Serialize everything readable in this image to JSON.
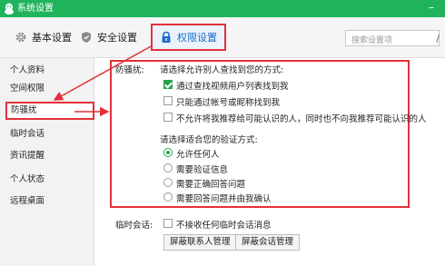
{
  "window": {
    "title": "系统设置",
    "minimize_glyph": "–",
    "logo_icon": "qq-penguin-icon"
  },
  "toolbar": {
    "tabs": [
      {
        "label": "基本设置",
        "icon": "gear-icon"
      },
      {
        "label": "安全设置",
        "icon": "shield-icon"
      },
      {
        "label": "权限设置",
        "icon": "lock-icon",
        "active": true
      }
    ],
    "search_placeholder": "搜索设置项",
    "search_edge_glyph": "/"
  },
  "sidebar": {
    "items": [
      {
        "label": "个人资料"
      },
      {
        "label": "空间权限"
      },
      {
        "label": "防骚扰",
        "active": true
      },
      {
        "label": "临时会话"
      },
      {
        "label": "资讯提醒"
      },
      {
        "label": "个人状态"
      },
      {
        "label": "远程桌面"
      }
    ]
  },
  "anti_harassment": {
    "label": "防骚扰:",
    "find_prompt": "请选择允许别人查找到您的方式:",
    "find_options": [
      {
        "label": "通过查找视频用户列表找到我",
        "checked": true
      },
      {
        "label": "只能通过帐号或昵称找到我",
        "checked": false
      },
      {
        "label": "不允许将我推荐给可能认识的人，同时也不向我推荐可能认识的人",
        "checked": false
      }
    ],
    "verify_prompt": "请选择适合您的验证方式:",
    "verify_options": [
      {
        "label": "允许任何人",
        "checked": true
      },
      {
        "label": "需要验证信息",
        "checked": false
      },
      {
        "label": "需要正确回答问题",
        "checked": false
      },
      {
        "label": "需要回答问题并由我确认",
        "checked": false
      }
    ]
  },
  "temp_session": {
    "label": "临时会话:",
    "option": {
      "label": "不接收任何临时会话消息",
      "checked": false
    },
    "buttons": [
      "屏蔽联系人管理",
      "屏蔽会话管理"
    ]
  },
  "colors": {
    "titlebar": "#21b35c",
    "highlight": "#e2313a",
    "accent_blue": "#1d6cc8",
    "check_green": "#26a34b"
  }
}
